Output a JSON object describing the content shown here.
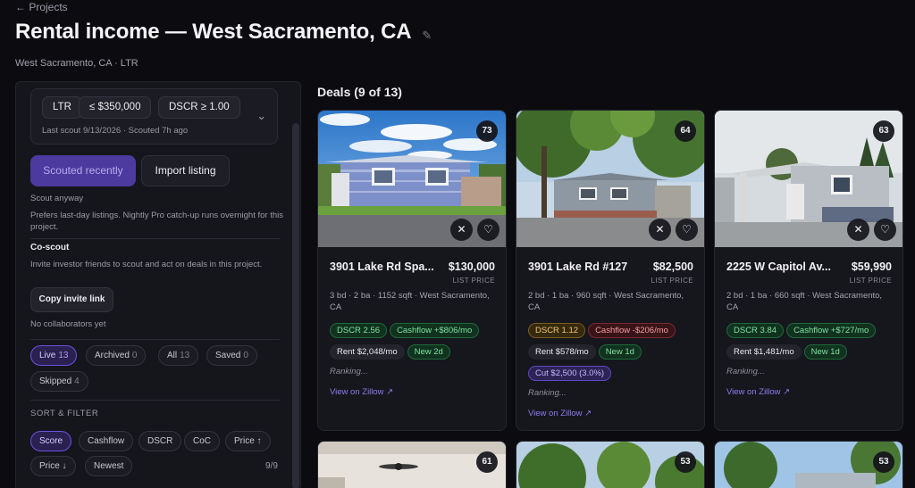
{
  "header": {
    "back_link": "← Projects",
    "title": "Rental income — West Sacramento, CA",
    "edit_icon": "pencil-icon",
    "subtitle": "West Sacramento, CA · LTR"
  },
  "sidebar": {
    "filters": {
      "chips": [
        "LTR",
        "≤ $350,000",
        "DSCR ≥ 1.00"
      ],
      "last_scout": "Last scout 9/13/2026 · Scouted 7h ago"
    },
    "scout_button": "Scouted recently",
    "import_button": "Import listing",
    "scout_anyway": "Scout anyway",
    "scout_note": "Prefers last-day listings. Nightly Pro catch-up runs overnight for this project.",
    "coscout": {
      "heading": "Co-scout",
      "description": "Invite investor friends to scout and act on deals in this project.",
      "copy_button": "Copy invite link",
      "collaborators": "No collaborators yet"
    },
    "status_tabs": [
      {
        "label": "Live",
        "count": "13"
      },
      {
        "label": "Archived",
        "count": "0"
      },
      {
        "label": "All",
        "count": "13"
      },
      {
        "label": "Saved",
        "count": "0"
      },
      {
        "label": "Skipped",
        "count": "4"
      }
    ],
    "sort_label": "SORT & FILTER",
    "sort_options": [
      "Score",
      "Cashflow",
      "DSCR",
      "CoC",
      "Price ↑",
      "Price ↓",
      "Newest"
    ],
    "result_count": "9/9"
  },
  "deals": {
    "heading": "Deals (9 of 13)",
    "list_price_label": "LIST PRICE",
    "ranking_text": "Ranking...",
    "zillow_link": "View on Zillow ↗",
    "cards": [
      {
        "score": "73",
        "address": "3901 Lake Rd Spa...",
        "price": "$130,000",
        "details": "3 bd · 2 ba · 1152 sqft · West Sacramento, CA",
        "badges_row1": [
          {
            "text": "DSCR 2.56",
            "tone": "green"
          },
          {
            "text": "Cashflow +$806/mo",
            "tone": "green"
          }
        ],
        "badges_row2": [
          {
            "text": "Rent $2,048/mo",
            "tone": "neutral"
          },
          {
            "text": "New 2d",
            "tone": "green"
          }
        ],
        "badges_row3": []
      },
      {
        "score": "64",
        "address": "3901 Lake Rd #127",
        "price": "$82,500",
        "details": "2 bd · 1 ba · 960 sqft · West Sacramento, CA",
        "badges_row1": [
          {
            "text": "DSCR 1.12",
            "tone": "amber"
          },
          {
            "text": "Cashflow -$206/mo",
            "tone": "red"
          }
        ],
        "badges_row2": [
          {
            "text": "Rent $578/mo",
            "tone": "neutral"
          },
          {
            "text": "New 1d",
            "tone": "green"
          }
        ],
        "badges_row3": [
          {
            "text": "Cut $2,500 (3.0%)",
            "tone": "purple"
          }
        ]
      },
      {
        "score": "63",
        "address": "2225 W Capitol Av...",
        "price": "$59,990",
        "details": "2 bd · 1 ba · 660 sqft · West Sacramento, CA",
        "badges_row1": [
          {
            "text": "DSCR 3.84",
            "tone": "green"
          },
          {
            "text": "Cashflow +$727/mo",
            "tone": "green"
          }
        ],
        "badges_row2": [
          {
            "text": "Rent $1,481/mo",
            "tone": "neutral"
          },
          {
            "text": "New 1d",
            "tone": "green"
          }
        ],
        "badges_row3": []
      }
    ],
    "bottom_scores": [
      "61",
      "53",
      "53"
    ]
  },
  "colors": {
    "accent": "#6c52e0",
    "background": "#0c0c10",
    "panel": "#15151c",
    "positive": "#7ee2a0",
    "negative": "#f39b9f",
    "warning": "#f1c76c"
  }
}
